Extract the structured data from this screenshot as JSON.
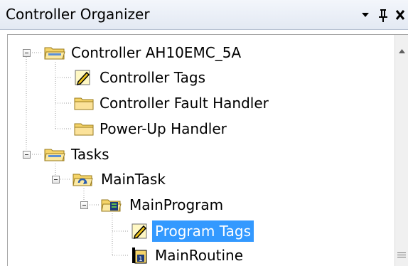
{
  "panel": {
    "title": "Controller Organizer"
  },
  "tree": {
    "controller": "Controller AH10EMC_5A",
    "controller_tags": "Controller Tags",
    "fault_handler": "Controller Fault Handler",
    "powerup_handler": "Power-Up Handler",
    "tasks": "Tasks",
    "main_task": "MainTask",
    "main_program": "MainProgram",
    "program_tags": "Program Tags",
    "main_routine": "MainRoutine"
  },
  "colors": {
    "selection": "#3399ff",
    "folder": "#f5d469"
  }
}
